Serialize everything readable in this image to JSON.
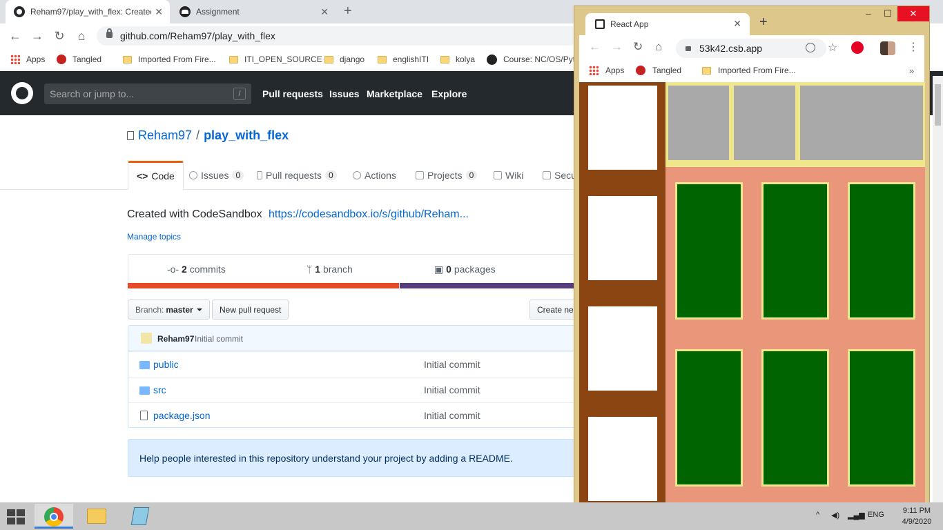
{
  "main_browser": {
    "tabs": [
      {
        "title": "Reham97/play_with_flex: Created with CodeSandbox",
        "active": true
      },
      {
        "title": "Assignment",
        "active": false
      }
    ],
    "url": "github.com/Reham97/play_with_flex",
    "bookmarks": [
      {
        "label": "Apps",
        "icon": "apps-grid-icon"
      },
      {
        "label": "Tangled",
        "icon": "tangled-icon"
      },
      {
        "label": "Imported From Fire...",
        "icon": "folder-icon"
      },
      {
        "label": "ITI_OPEN_SOURCE",
        "icon": "folder-icon"
      },
      {
        "label": "django",
        "icon": "folder-icon"
      },
      {
        "label": "englishITI",
        "icon": "folder-icon"
      },
      {
        "label": "kolya",
        "icon": "folder-icon"
      },
      {
        "label": "Course: NC/OS/Pyt",
        "icon": "moodle-icon"
      }
    ]
  },
  "github": {
    "search_placeholder": "Search or jump to...",
    "search_shortcut": "/",
    "nav": [
      "Pull requests",
      "Issues",
      "Marketplace",
      "Explore"
    ],
    "repo_owner": "Reham97",
    "repo_separator": "/",
    "repo_name": "play_with_flex",
    "repo_nav": [
      {
        "label": "Code",
        "counter": ""
      },
      {
        "label": "Issues",
        "counter": "0"
      },
      {
        "label": "Pull requests",
        "counter": "0"
      },
      {
        "label": "Actions",
        "counter": ""
      },
      {
        "label": "Projects",
        "counter": "0"
      },
      {
        "label": "Wiki",
        "counter": ""
      },
      {
        "label": "Secu",
        "counter": ""
      }
    ],
    "description": "Created with CodeSandbox",
    "description_link": "https://codesandbox.io/s/github/Reham...",
    "manage_topics": "Manage topics",
    "summary": {
      "commits_count": "2",
      "commits_label": "commits",
      "branch_count": "1",
      "branch_label": "branch",
      "packages_count": "0",
      "packages_label": "packages"
    },
    "lang_colors": [
      "#e34c26",
      "#563d7c"
    ],
    "branch_prefix": "Branch:",
    "branch_name": "master",
    "new_pull_request": "New pull request",
    "create_new": "Create ne",
    "commit_author": "Reham97",
    "commit_message": "Initial commit",
    "files": [
      {
        "name": "public",
        "type": "folder",
        "message": "Initial commit"
      },
      {
        "name": "src",
        "type": "folder",
        "message": "Initial commit"
      },
      {
        "name": "package.json",
        "type": "file",
        "message": "Initial commit"
      }
    ],
    "readme_prompt": "Help people interested in this repository understand your project by adding a README."
  },
  "popup_browser": {
    "tab_title": "React App",
    "url": "53k42.csb.app",
    "bookmarks": [
      "Apps",
      "Tangled",
      "Imported From Fire..."
    ],
    "colors": {
      "background": "#e9967a",
      "sidebar": "#8b4513",
      "topbar": "#f0e68c",
      "top_boxes": "#a9a9a9",
      "green_boxes": "#006400",
      "side_boxes": "#ffffff"
    }
  },
  "taskbar": {
    "language": "ENG",
    "time": "9:11 PM",
    "date": "4/9/2020"
  }
}
